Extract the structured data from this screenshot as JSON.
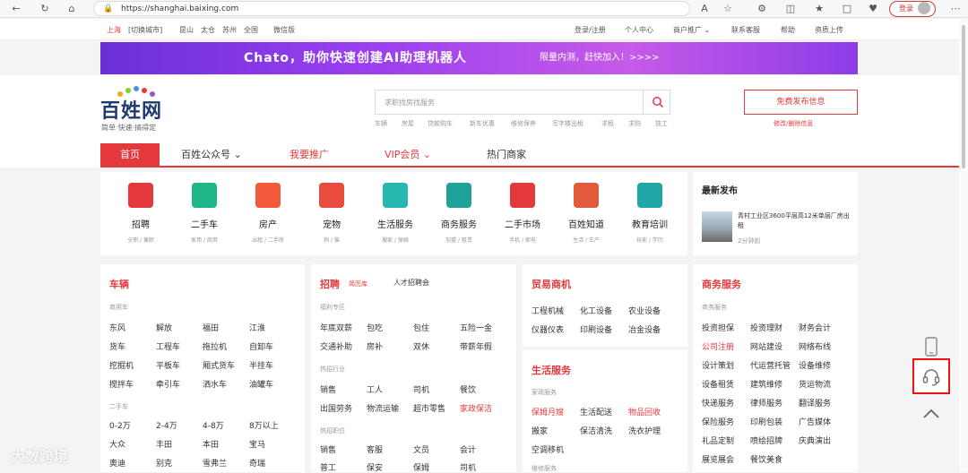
{
  "browser": {
    "url": "https://shanghai.baixing.com",
    "login_label": "登录"
  },
  "topbar": {
    "city": "上海",
    "switch_city": "[切换城市]",
    "nearby": [
      "昆山",
      "太仓",
      "苏州",
      "全国"
    ],
    "wechat": "微信版",
    "login_register": "登录/注册",
    "user_center": "个人中心",
    "merchant_promo": "商户推广",
    "customer_service": "联系客服",
    "help": "帮助",
    "upload": "资质上传"
  },
  "banner": {
    "text": "Chato，助你快速创建AI助理机器人",
    "sub": "限量内测，赶快加入！>>>>"
  },
  "header": {
    "logo": "百姓网",
    "slogan": "简单·快速·搞得定",
    "search_placeholder": "求职找房找服务",
    "hot_keywords": [
      "车辆",
      "房屋",
      "贷款购车",
      "新车优惠",
      "维修保养",
      "写字楼出租",
      "求租",
      "求购",
      "技工"
    ],
    "post_button": "免费发布信息",
    "post_sub": "修改/删除信息"
  },
  "nav": {
    "items": [
      "首页",
      "百姓公众号",
      "我要推广",
      "VIP会员",
      "热门商家"
    ]
  },
  "categories": [
    {
      "name": "招聘",
      "sub": "全职 / 兼职",
      "color": "#e4393c"
    },
    {
      "name": "二手车",
      "sub": "家用 / 商用",
      "color": "#1fb68a"
    },
    {
      "name": "房产",
      "sub": "出租 / 二手房",
      "color": "#f25a3b"
    },
    {
      "name": "宠物",
      "sub": "狗 / 猫",
      "color": "#e84c3d"
    },
    {
      "name": "生活服务",
      "sub": "搬家 / 保姆",
      "color": "#25b7b0"
    },
    {
      "name": "商务服务",
      "sub": "加盟 / 租赁",
      "color": "#1ea39a"
    },
    {
      "name": "二手市场",
      "sub": "手机 / 家电",
      "color": "#e4393c"
    },
    {
      "name": "百姓知道",
      "sub": "生活 / 车产",
      "color": "#e25a3a"
    },
    {
      "name": "教育培训",
      "sub": "技能 / 学历",
      "color": "#1fa7a5"
    }
  ],
  "latest": {
    "title": "最新发布",
    "item_text": "青村工业区3600平层高12米单层厂房出租",
    "item_time": "2分钟前"
  },
  "vehicles": {
    "title": "车辆",
    "sub1": "商用车",
    "rows1": [
      [
        "东风",
        "解放",
        "福田",
        "江淮"
      ],
      [
        "货车",
        "工程车",
        "拖拉机",
        "自卸车"
      ],
      [
        "挖掘机",
        "平板车",
        "厢式货车",
        "半挂车"
      ],
      [
        "搅拌车",
        "牵引车",
        "洒水车",
        "油罐车"
      ]
    ],
    "sub2": "二手车",
    "rows2": [
      [
        "0-2万",
        "2-4万",
        "4-8万",
        "8万以上"
      ],
      [
        "大众",
        "丰田",
        "本田",
        "宝马"
      ],
      [
        "奥迪",
        "别克",
        "雪弗兰",
        "奇瑞"
      ]
    ]
  },
  "jobs": {
    "title": "招聘",
    "tag": "简历库",
    "link": "人才招聘会",
    "sub1": "福利专区",
    "rows1": [
      [
        "年底双薪",
        "包吃",
        "包住",
        "五险一金"
      ],
      [
        "交通补助",
        "房补",
        "双休",
        "带薪年假"
      ]
    ],
    "sub2": "热招行业",
    "rows2": [
      [
        "销售",
        "工人",
        "司机",
        "餐饮"
      ],
      [
        "出国劳务",
        "物流运输",
        "超市零售",
        "家政保洁"
      ]
    ],
    "sub3": "热招职位",
    "rows3": [
      [
        "销售",
        "客服",
        "文员",
        "会计"
      ],
      [
        "普工",
        "保安",
        "保姆",
        "司机"
      ]
    ]
  },
  "trade": {
    "title": "贸易商机",
    "rows": [
      [
        "工程机械",
        "化工设备",
        "农业设备"
      ],
      [
        "仪器仪表",
        "印刷设备",
        "冶金设备"
      ]
    ]
  },
  "life": {
    "title": "生活服务",
    "sub": "家政服务",
    "rows": [
      [
        "保姆月嫂",
        "生活配送",
        "物品回收"
      ],
      [
        "搬家",
        "保洁清洗",
        "洗衣护理"
      ],
      [
        "空调移机"
      ]
    ],
    "sub2": "维修服务"
  },
  "business": {
    "title": "商务服务",
    "sub": "商务服务",
    "rows": [
      [
        "投资担保",
        "投资理财",
        "财务会计"
      ],
      [
        "公司注册",
        "网站建设",
        "网络布线"
      ],
      [
        "设计策划",
        "代运营托管",
        "设备维修"
      ],
      [
        "设备租赁",
        "建筑维修",
        "货运物流"
      ],
      [
        "快递服务",
        "律师服务",
        "翻译服务"
      ],
      [
        "保险服务",
        "印刷包装",
        "广告媒体"
      ],
      [
        "礼品定制",
        "喷绘招牌",
        "庆典演出"
      ],
      [
        "展览展会",
        "餐饮美食"
      ]
    ]
  },
  "watermark": "大数跨境"
}
